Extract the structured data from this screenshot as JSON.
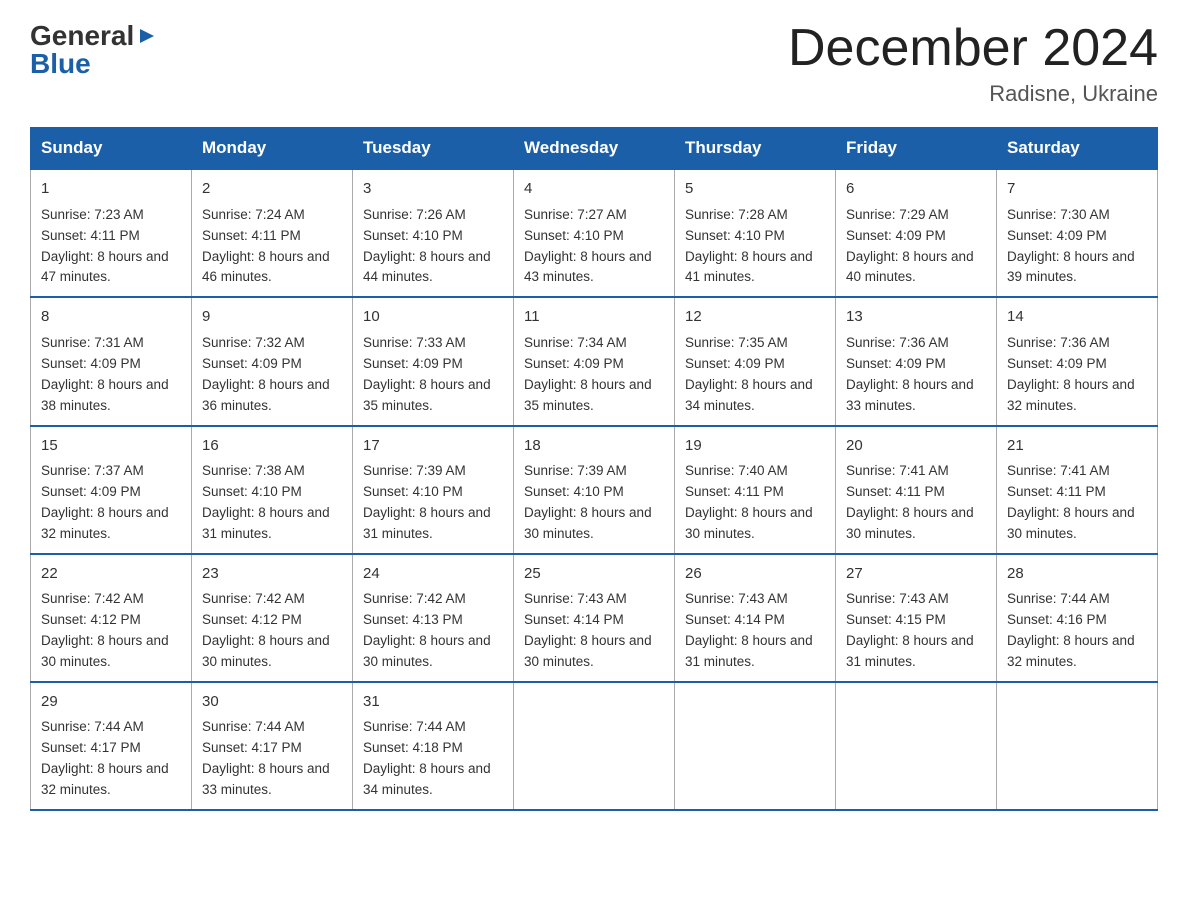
{
  "logo": {
    "line1": "General",
    "triangle": "▶",
    "line2": "Blue"
  },
  "title": "December 2024",
  "location": "Radisne, Ukraine",
  "days_header": [
    "Sunday",
    "Monday",
    "Tuesday",
    "Wednesday",
    "Thursday",
    "Friday",
    "Saturday"
  ],
  "weeks": [
    [
      {
        "num": "1",
        "sunrise": "7:23 AM",
        "sunset": "4:11 PM",
        "daylight": "8 hours and 47 minutes."
      },
      {
        "num": "2",
        "sunrise": "7:24 AM",
        "sunset": "4:11 PM",
        "daylight": "8 hours and 46 minutes."
      },
      {
        "num": "3",
        "sunrise": "7:26 AM",
        "sunset": "4:10 PM",
        "daylight": "8 hours and 44 minutes."
      },
      {
        "num": "4",
        "sunrise": "7:27 AM",
        "sunset": "4:10 PM",
        "daylight": "8 hours and 43 minutes."
      },
      {
        "num": "5",
        "sunrise": "7:28 AM",
        "sunset": "4:10 PM",
        "daylight": "8 hours and 41 minutes."
      },
      {
        "num": "6",
        "sunrise": "7:29 AM",
        "sunset": "4:09 PM",
        "daylight": "8 hours and 40 minutes."
      },
      {
        "num": "7",
        "sunrise": "7:30 AM",
        "sunset": "4:09 PM",
        "daylight": "8 hours and 39 minutes."
      }
    ],
    [
      {
        "num": "8",
        "sunrise": "7:31 AM",
        "sunset": "4:09 PM",
        "daylight": "8 hours and 38 minutes."
      },
      {
        "num": "9",
        "sunrise": "7:32 AM",
        "sunset": "4:09 PM",
        "daylight": "8 hours and 36 minutes."
      },
      {
        "num": "10",
        "sunrise": "7:33 AM",
        "sunset": "4:09 PM",
        "daylight": "8 hours and 35 minutes."
      },
      {
        "num": "11",
        "sunrise": "7:34 AM",
        "sunset": "4:09 PM",
        "daylight": "8 hours and 35 minutes."
      },
      {
        "num": "12",
        "sunrise": "7:35 AM",
        "sunset": "4:09 PM",
        "daylight": "8 hours and 34 minutes."
      },
      {
        "num": "13",
        "sunrise": "7:36 AM",
        "sunset": "4:09 PM",
        "daylight": "8 hours and 33 minutes."
      },
      {
        "num": "14",
        "sunrise": "7:36 AM",
        "sunset": "4:09 PM",
        "daylight": "8 hours and 32 minutes."
      }
    ],
    [
      {
        "num": "15",
        "sunrise": "7:37 AM",
        "sunset": "4:09 PM",
        "daylight": "8 hours and 32 minutes."
      },
      {
        "num": "16",
        "sunrise": "7:38 AM",
        "sunset": "4:10 PM",
        "daylight": "8 hours and 31 minutes."
      },
      {
        "num": "17",
        "sunrise": "7:39 AM",
        "sunset": "4:10 PM",
        "daylight": "8 hours and 31 minutes."
      },
      {
        "num": "18",
        "sunrise": "7:39 AM",
        "sunset": "4:10 PM",
        "daylight": "8 hours and 30 minutes."
      },
      {
        "num": "19",
        "sunrise": "7:40 AM",
        "sunset": "4:11 PM",
        "daylight": "8 hours and 30 minutes."
      },
      {
        "num": "20",
        "sunrise": "7:41 AM",
        "sunset": "4:11 PM",
        "daylight": "8 hours and 30 minutes."
      },
      {
        "num": "21",
        "sunrise": "7:41 AM",
        "sunset": "4:11 PM",
        "daylight": "8 hours and 30 minutes."
      }
    ],
    [
      {
        "num": "22",
        "sunrise": "7:42 AM",
        "sunset": "4:12 PM",
        "daylight": "8 hours and 30 minutes."
      },
      {
        "num": "23",
        "sunrise": "7:42 AM",
        "sunset": "4:12 PM",
        "daylight": "8 hours and 30 minutes."
      },
      {
        "num": "24",
        "sunrise": "7:42 AM",
        "sunset": "4:13 PM",
        "daylight": "8 hours and 30 minutes."
      },
      {
        "num": "25",
        "sunrise": "7:43 AM",
        "sunset": "4:14 PM",
        "daylight": "8 hours and 30 minutes."
      },
      {
        "num": "26",
        "sunrise": "7:43 AM",
        "sunset": "4:14 PM",
        "daylight": "8 hours and 31 minutes."
      },
      {
        "num": "27",
        "sunrise": "7:43 AM",
        "sunset": "4:15 PM",
        "daylight": "8 hours and 31 minutes."
      },
      {
        "num": "28",
        "sunrise": "7:44 AM",
        "sunset": "4:16 PM",
        "daylight": "8 hours and 32 minutes."
      }
    ],
    [
      {
        "num": "29",
        "sunrise": "7:44 AM",
        "sunset": "4:17 PM",
        "daylight": "8 hours and 32 minutes."
      },
      {
        "num": "30",
        "sunrise": "7:44 AM",
        "sunset": "4:17 PM",
        "daylight": "8 hours and 33 minutes."
      },
      {
        "num": "31",
        "sunrise": "7:44 AM",
        "sunset": "4:18 PM",
        "daylight": "8 hours and 34 minutes."
      },
      null,
      null,
      null,
      null
    ]
  ]
}
